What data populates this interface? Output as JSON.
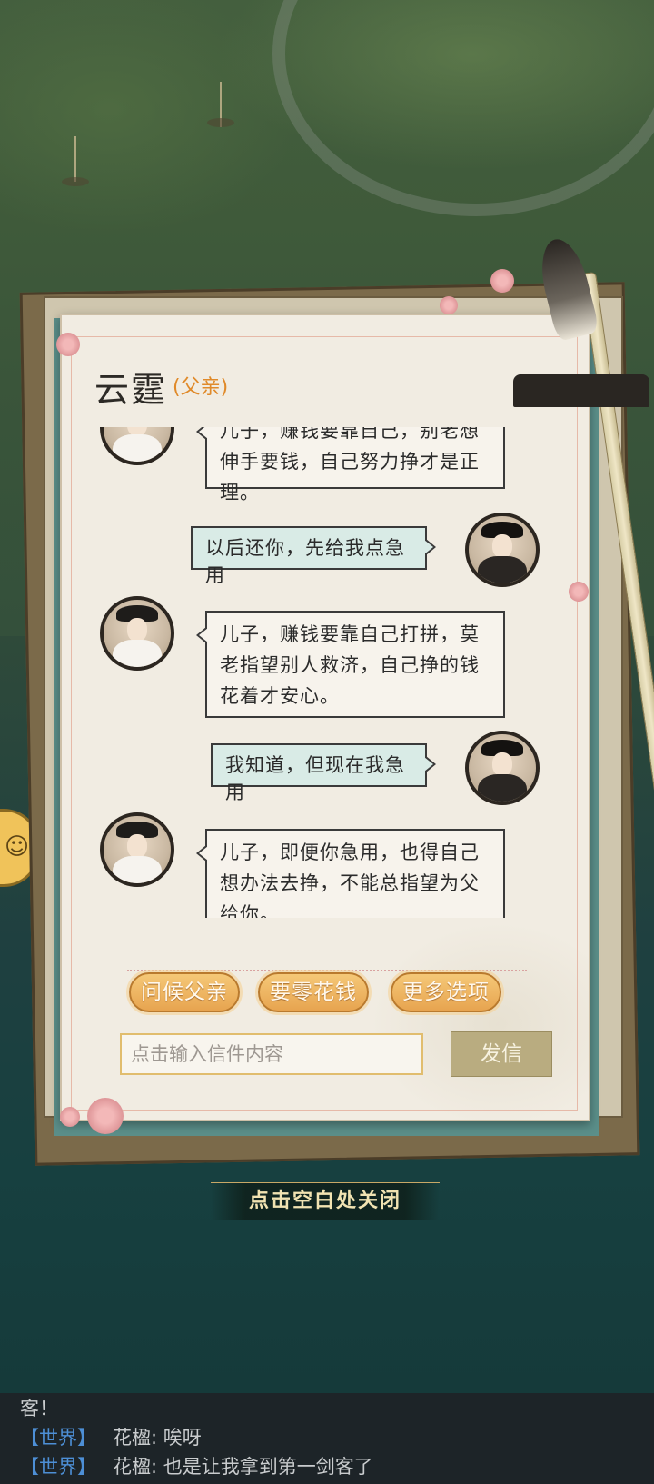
{
  "letter": {
    "sender_name": "云霆",
    "sender_relation": "(父亲)"
  },
  "messages": [
    {
      "from": "father",
      "text": "儿子，赚钱要靠自己，别老想伸手要钱，自己努力挣才是正理。"
    },
    {
      "from": "son",
      "text": "以后还你，先给我点急用"
    },
    {
      "from": "father",
      "text": "儿子，赚钱要靠自己打拼，莫老指望别人救济，自己挣的钱花着才安心。"
    },
    {
      "from": "son",
      "text": "我知道，但现在我急用"
    },
    {
      "from": "father",
      "text": "儿子，即便你急用，也得自己想办法去挣，不能总指望为父给你。"
    }
  ],
  "options": [
    "问候父亲",
    "要零花钱",
    "更多选项"
  ],
  "input": {
    "placeholder": "点击输入信件内容",
    "value": ""
  },
  "send_label": "发信",
  "close_hint": "点击空白处关闭",
  "world_chat": {
    "partial": "客！",
    "lines": [
      {
        "channel": "【世界】",
        "user": "花楹:",
        "text": "唉呀"
      },
      {
        "channel": "【世界】",
        "user": "花楹:",
        "text": "也是让我拿到第一剑客了"
      }
    ]
  },
  "colors": {
    "accent": "#e08a2a",
    "option_button": "#e7a450",
    "channel": "#4d8fd6"
  }
}
